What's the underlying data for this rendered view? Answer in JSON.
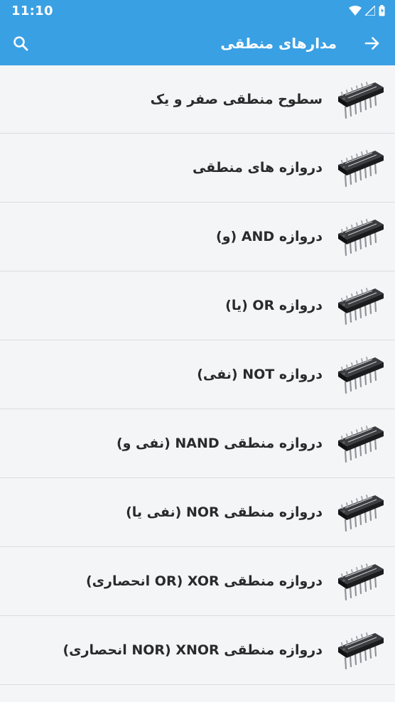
{
  "status_bar": {
    "time": "11:10",
    "icons": [
      "wifi-icon",
      "signal-icon",
      "battery-icon"
    ]
  },
  "app_bar": {
    "title": "مدارهای منطقی",
    "back_icon": "arrow-right-icon",
    "search_icon": "search-icon"
  },
  "colors": {
    "primary": "#3aa0e4",
    "background": "#f4f5f7",
    "divider": "#dadcdf",
    "text": "#2a2a2a"
  },
  "items": [
    {
      "label": "سطوح منطقی صفر و یک",
      "icon": "ic-chip-icon"
    },
    {
      "label": "دروازه های منطقی",
      "icon": "ic-chip-icon"
    },
    {
      "label": "دروازه AND (و)",
      "icon": "ic-chip-icon"
    },
    {
      "label": "دروازه OR (یا)",
      "icon": "ic-chip-icon"
    },
    {
      "label": "دروازه NOT (نفی)",
      "icon": "ic-chip-icon"
    },
    {
      "label": "دروازه منطقی NAND (نفی و)",
      "icon": "ic-chip-icon"
    },
    {
      "label": "دروازه منطقی NOR (نفی یا)",
      "icon": "ic-chip-icon"
    },
    {
      "label": "دروازه منطقی XOR (OR انحصاری)",
      "icon": "ic-chip-icon"
    },
    {
      "label": "دروازه منطقی XNOR (NOR انحصاری)",
      "icon": "ic-chip-icon"
    }
  ]
}
